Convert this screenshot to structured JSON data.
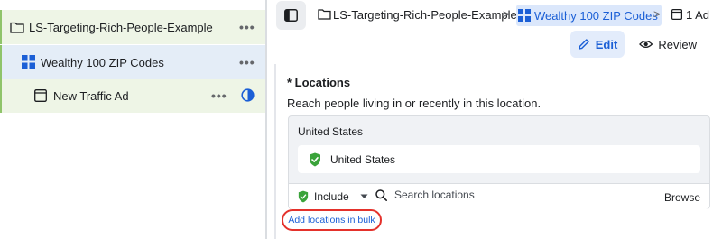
{
  "tree": {
    "campaign": {
      "label": "LS-Targeting-Rich-People-Example",
      "icon": "folder-icon"
    },
    "adset": {
      "label": "Wealthy 100 ZIP Codes",
      "icon": "grid-icon"
    },
    "ad": {
      "label": "New Traffic Ad",
      "icon": "ad-icon",
      "status_icon": "half-circle-icon"
    },
    "more_label": "•••"
  },
  "breadcrumb": {
    "campaign": "LS-Targeting-Rich-People-Example",
    "adset": "Wealthy 100 ZIP Codes",
    "ad_count": "1 Ad",
    "separator": ">"
  },
  "toolbar": {
    "edit_label": "Edit",
    "review_label": "Review"
  },
  "locations": {
    "title": "* Locations",
    "description": "Reach people living in or recently in this location.",
    "group_label": "United States",
    "selected": "United States",
    "include_label": "Include",
    "search_placeholder": "Search locations",
    "browse_label": "Browse",
    "bulk_link": "Add locations in bulk"
  },
  "colors": {
    "accent": "#1b5fd6",
    "success": "#3aa33a",
    "highlight_ring": "#e4312b"
  }
}
